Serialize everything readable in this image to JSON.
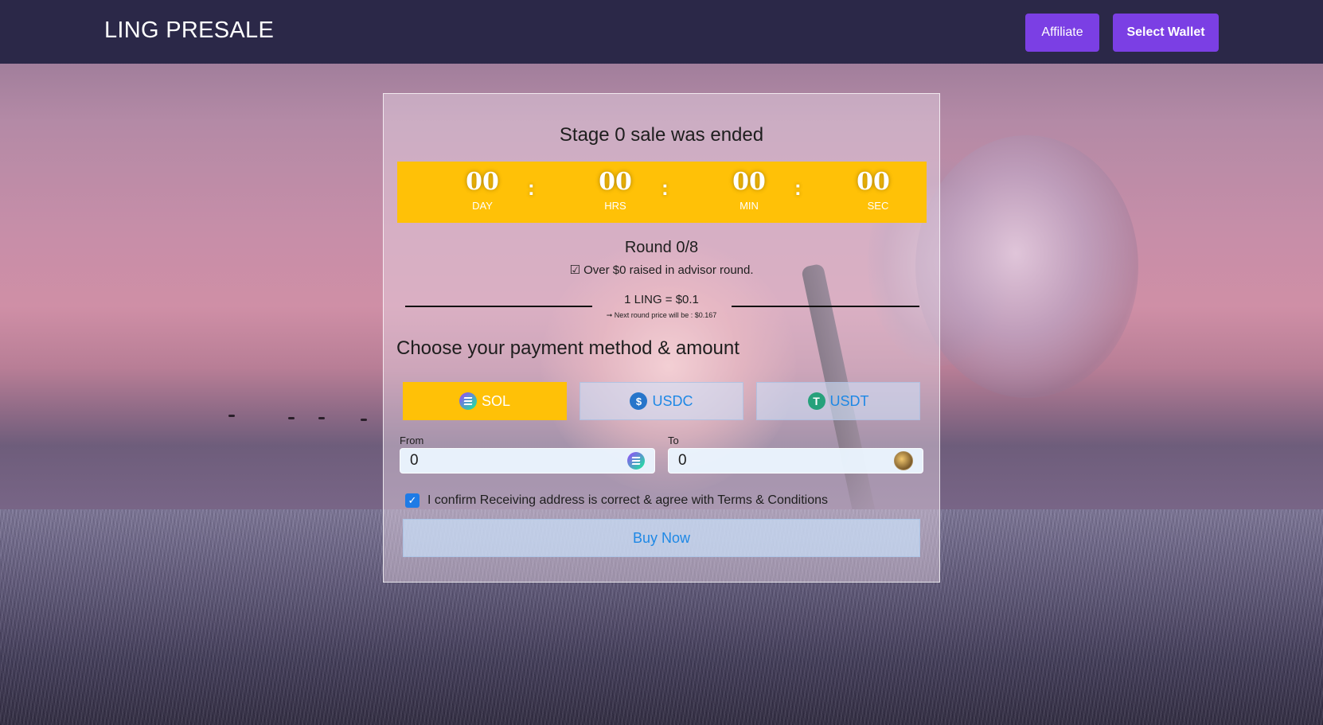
{
  "header": {
    "brand": "LING PRESALE",
    "affiliate_label": "Affiliate",
    "select_wallet_label": "Select Wallet"
  },
  "presale": {
    "title": "Stage 0 sale was ended",
    "countdown": [
      {
        "value": "00",
        "label": "DAY"
      },
      {
        "value": "00",
        "label": "HRS"
      },
      {
        "value": "00",
        "label": "MIN"
      },
      {
        "value": "00",
        "label": "SEC"
      }
    ],
    "separator": ":",
    "round": "Round 0/8",
    "raised": "☑ Over $0 raised in advisor round.",
    "price": "1 LING = $0.1",
    "next_price": "➞ Next round price will be : $0.167",
    "choose_heading": "Choose your payment method & amount",
    "payment_methods": [
      {
        "label": "SOL",
        "icon": "solana-icon",
        "selected": true
      },
      {
        "label": "USDC",
        "icon": "usdc-icon",
        "selected": false
      },
      {
        "label": "USDT",
        "icon": "tether-icon",
        "selected": false
      }
    ],
    "from": {
      "label": "From",
      "value": "0",
      "token_icon": "solana-icon"
    },
    "to": {
      "label": "To",
      "value": "0",
      "token_icon": "ling-token-icon"
    },
    "confirm_text": "I confirm Receiving address is correct & agree with Terms & Conditions",
    "confirm_checked": true,
    "buy_label": "Buy Now"
  },
  "colors": {
    "header_bg": "#2b2848",
    "button_purple": "#7b3fe4",
    "timer_yellow": "#ffc107",
    "link_blue": "#1e88e5",
    "checkbox_blue": "#1e7be6"
  }
}
